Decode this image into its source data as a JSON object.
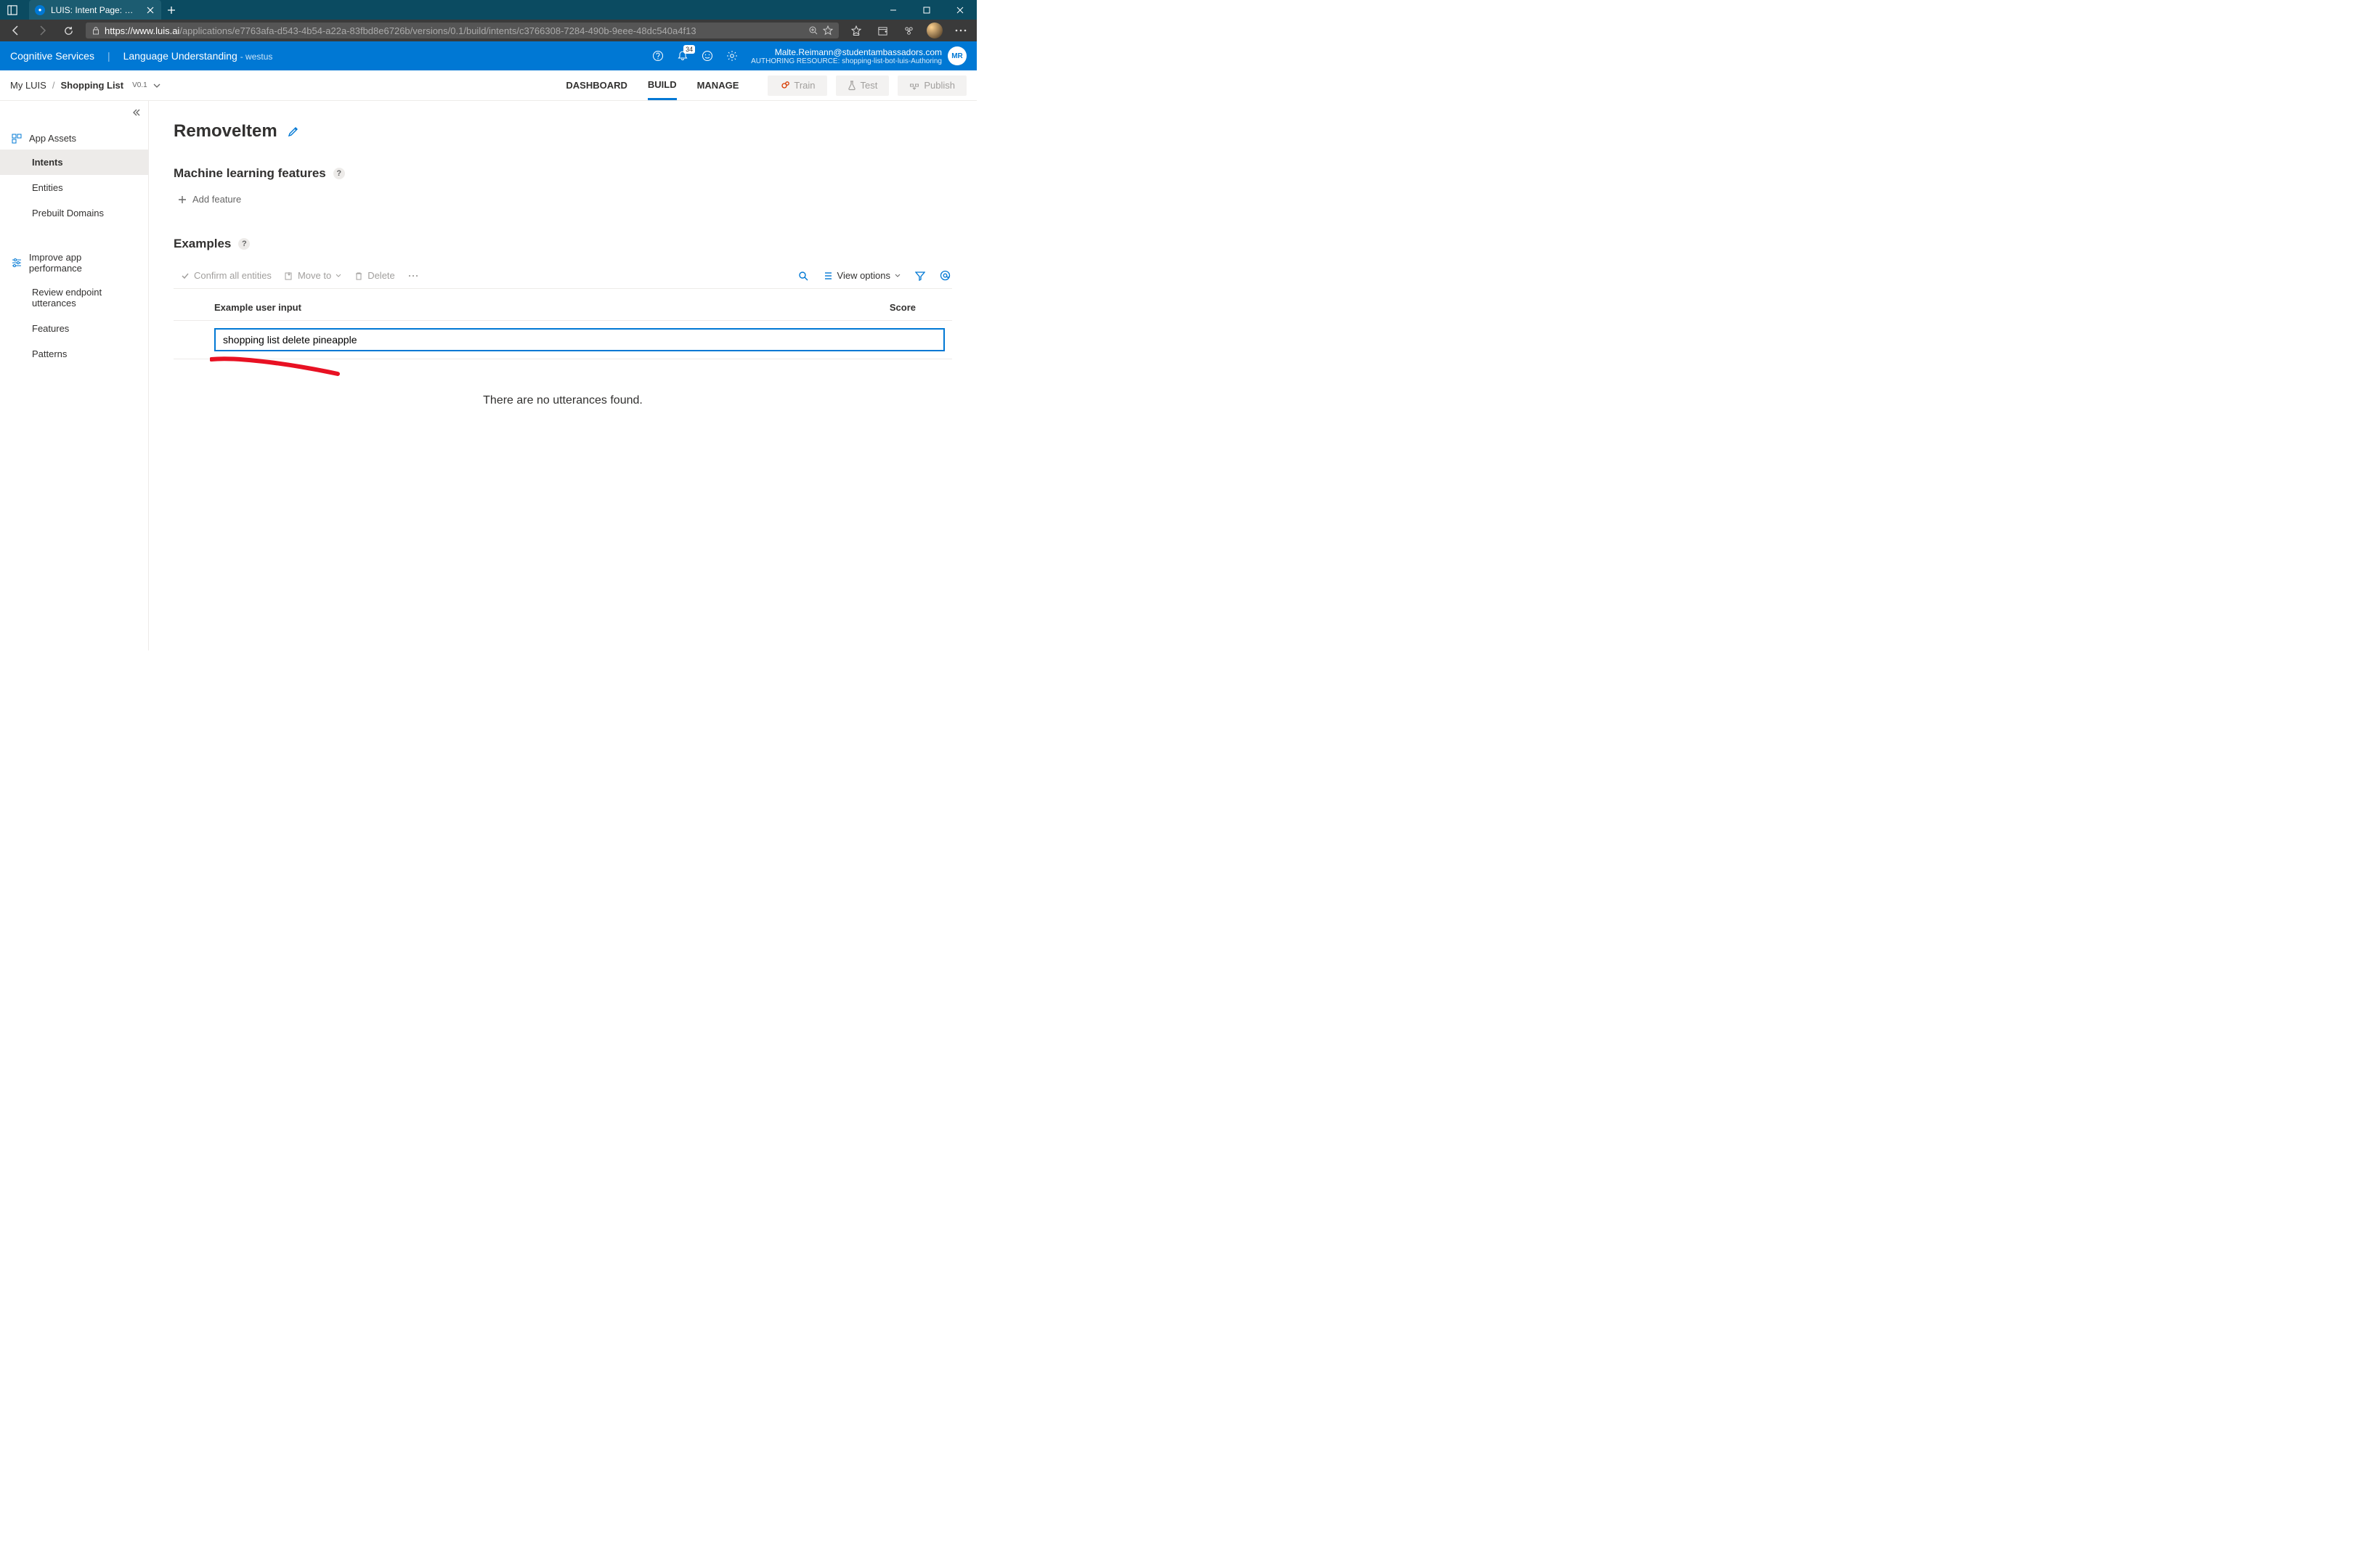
{
  "browser": {
    "tab_title": "LUIS: Intent Page: RemoveItem",
    "url_host": "https://www.luis.ai",
    "url_path": "/applications/e7763afa-d543-4b54-a22a-83fbd8e6726b/versions/0.1/build/intents/c3766308-7284-490b-9eee-48dc540a4f13"
  },
  "header": {
    "brand": "Cognitive Services",
    "subbrand": "Language Understanding",
    "region": "- westus",
    "notification_count": "34",
    "user_email": "Malte.Reimann@studentambassadors.com",
    "resource_label": "AUTHORING RESOURCE:",
    "resource_value": "shopping-list-bot-luis-Authoring",
    "user_initials": "MR"
  },
  "cmdbar": {
    "crumb_root": "My LUIS",
    "crumb_app": "Shopping List",
    "version": "V0.1",
    "tabs": {
      "dashboard": "DASHBOARD",
      "build": "BUILD",
      "manage": "MANAGE"
    },
    "actions": {
      "train": "Train",
      "test": "Test",
      "publish": "Publish"
    }
  },
  "sidebar": {
    "group1_head": "App Assets",
    "group1_items": [
      "Intents",
      "Entities",
      "Prebuilt Domains"
    ],
    "group2_head": "Improve app performance",
    "group2_items": [
      "Review endpoint utterances",
      "Features",
      "Patterns"
    ]
  },
  "page": {
    "title": "RemoveItem",
    "ml_features_title": "Machine learning features",
    "add_feature": "Add feature",
    "examples_title": "Examples",
    "toolbar": {
      "confirm": "Confirm all entities",
      "move_to": "Move to",
      "delete": "Delete",
      "view_options": "View options"
    },
    "columns": {
      "input": "Example user input",
      "score": "Score"
    },
    "input_value": "shopping list delete pineapple",
    "empty_msg": "There are no utterances found."
  }
}
